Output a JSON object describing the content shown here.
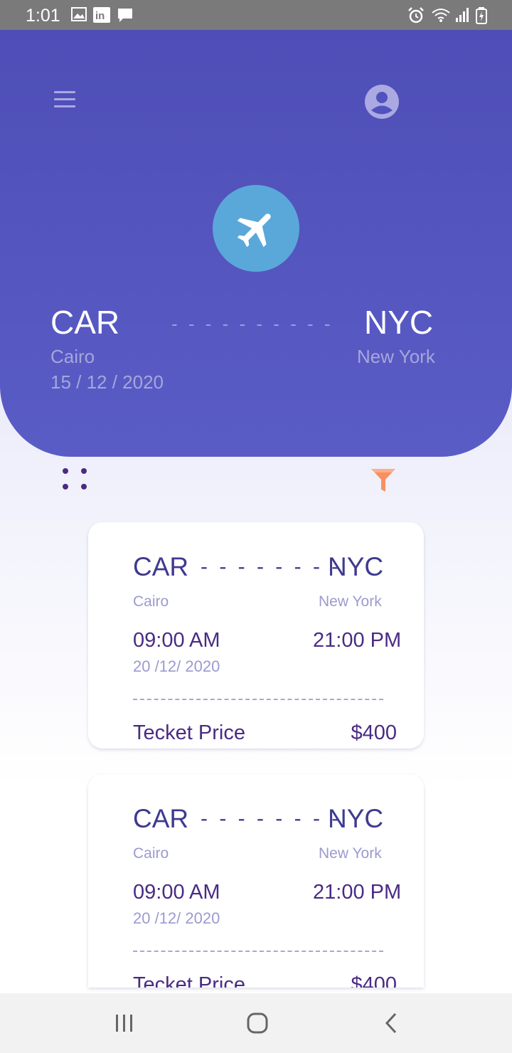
{
  "status_bar": {
    "time": "1:01"
  },
  "header": {
    "origin": {
      "code": "CAR",
      "city": "Cairo",
      "date": "15 / 12 / 2020"
    },
    "destination": {
      "code": "NYC",
      "city": "New York"
    },
    "route_dashes": "- - - - - - - - - -"
  },
  "flights": [
    {
      "from_code": "CAR",
      "to_code": "NYC",
      "dashes": "- - - - - - - -",
      "from_city": "Cairo",
      "to_city": "New York",
      "depart_time": "09:00 AM",
      "arrive_time": "21:00 PM",
      "date": "20 /12/ 2020",
      "price_label": "Tecket Price",
      "price": "$400"
    },
    {
      "from_code": "CAR",
      "to_code": "NYC",
      "dashes": "- - - - - - - -",
      "from_city": "Cairo",
      "to_city": "New York",
      "depart_time": "09:00 AM",
      "arrive_time": "21:00 PM",
      "date": "20 /12/ 2020",
      "price_label": "Tecket Price",
      "price": "$400"
    }
  ],
  "icons": [
    "menu-icon",
    "profile-icon",
    "plane-icon",
    "grid-icon",
    "filter-icon",
    "recents-icon",
    "home-icon",
    "back-icon"
  ],
  "colors": {
    "header": "#5152bd",
    "plane_circle": "#5aa8da",
    "filter": "#f8905f",
    "text_dark": "#4a2b84"
  }
}
